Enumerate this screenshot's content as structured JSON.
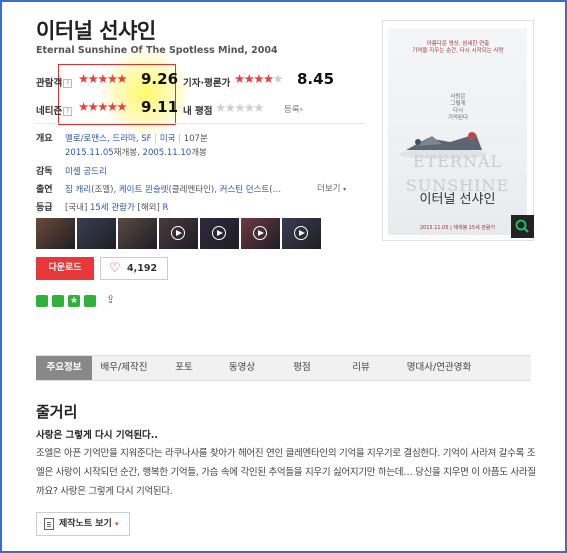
{
  "movie": {
    "title": "이터널 선샤인",
    "subtitle": "Eternal Sunshine Of The Spotless Mind, 2004"
  },
  "ratings": {
    "audience_label": "관람객",
    "audience_score": "9.26",
    "audience_stars": 4.6,
    "critics_label": "기자·평론가",
    "critics_score": "8.45",
    "critics_stars": 4.2,
    "netizen_label": "네티즌",
    "netizen_score": "9.11",
    "netizen_stars": 4.6,
    "my_rating_label": "내 평점",
    "my_rating_action": "등록›",
    "help_mark": "?",
    "highlight_color": "#e03030"
  },
  "info": {
    "overview_label": "개요",
    "genre": "멜로/로맨스, 드라마, SF",
    "country": "미국",
    "runtime": "107분",
    "release1": "2015.11.05",
    "release1_suffix": "재개봉,",
    "release2": "2005.11.10",
    "release2_suffix": "개봉",
    "director_label": "감독",
    "director": "미셸 공드리",
    "cast_label": "출연",
    "cast_actor1": "짐 캐리",
    "cast_role1": "(조엘),",
    "cast_actor2": "케이트 윈슬렛",
    "cast_role2": "(클레멘타인),",
    "cast_actor3": "커스틴 던스트",
    "cast_more_suffix": "(…",
    "cast_more_button": "더보기",
    "grade_label": "등급",
    "grade_domestic_prefix": "[국내]",
    "grade_domestic": "15세 관람가",
    "grade_foreign_prefix": "[해외]",
    "grade_foreign": "R"
  },
  "thumbnails": [
    {
      "name": "still-1",
      "video": false,
      "color": "#6b4a3a"
    },
    {
      "name": "still-2",
      "video": false,
      "color": "#3a3f52"
    },
    {
      "name": "still-3",
      "video": false,
      "color": "#5a4a44"
    },
    {
      "name": "video-1",
      "video": true,
      "color": "#4a3a3e"
    },
    {
      "name": "video-2",
      "video": true,
      "color": "#2e2a3e"
    },
    {
      "name": "video-3",
      "video": true,
      "color": "#6e3a44"
    },
    {
      "name": "video-4",
      "video": true,
      "color": "#3a3e52"
    }
  ],
  "actions": {
    "download_label": "다운로드",
    "like_count": "4,192",
    "accent_color": "#e8383c"
  },
  "social_icons": [
    "band-icon",
    "line-icon",
    "star-icon",
    "kakao-icon"
  ],
  "poster": {
    "tagline": "아름다운 영상, 섬세한 연출",
    "tagline2": "기억을 지우는 순간, 다시 시작되는 사랑",
    "side_text": [
      "사랑은",
      "그렇게",
      "다시",
      "기억된다"
    ],
    "title_line1": "ETERNAL",
    "title_line2": "SUNSHINE",
    "title_korean": "이터널 선샤인",
    "date": "2015.11.05 | 재개봉 15세 관람가"
  },
  "tabs": [
    "주요정보",
    "배우/제작진",
    "포토",
    "동영상",
    "평점",
    "리뷰",
    "명대사/연관영화"
  ],
  "synopsis": {
    "section_title": "줄거리",
    "tagline": "사랑은 그렇게 다시 기억된다..",
    "body": "조엘은 아픈 기억만을 지워준다는 라쿠나사를 찾아가 헤어진 연인 클레멘타인의 기억을 지우기로 결심한다. 기억이 사라져 갈수록 조엘은 사랑이 시작되던 순간, 행복한 기억들, 가슴 속에 각인된 추억들을 지우기 싫어지기만 하는데… 당신을 지우면 이 아픔도 사라질까요? 사랑은 그렇게 다시 기억된다.",
    "note_button": "제작노트 보기",
    "note_caret": "▾"
  }
}
